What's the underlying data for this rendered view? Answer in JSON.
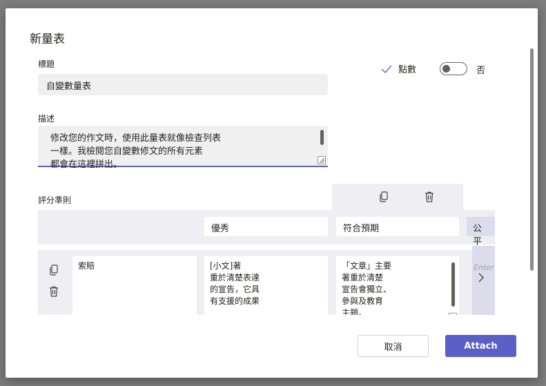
{
  "dialog": {
    "title": "新量表"
  },
  "form": {
    "title_label": "標題",
    "title_value": "自變數量表",
    "description_label": "描述",
    "description_value": "修改您的作文時，使用此量表就像檢查列表\n一樣。我檢閱您自變數修文的所有元素\n都會在這裡拼出。"
  },
  "points": {
    "label": "點數",
    "toggle_state": "否"
  },
  "rubric": {
    "label": "評分準則",
    "levels": [
      "優秀",
      "符合預期",
      "公平"
    ],
    "criterion": {
      "name": "索賠",
      "cells": [
        "[小文]著\n重於清楚表達\n的宣告，它具\n有支援的成果",
        "「文章」主要\n著重於清楚\n宣告會獨立、\n參與及教育\n主題。"
      ]
    },
    "new_level_placeholder": "Enter"
  },
  "buttons": {
    "cancel": "取消",
    "attach": "Attach"
  },
  "colors": {
    "accent": "#5b5fc7",
    "panel": "#efeff3"
  },
  "icons": [
    "check-icon",
    "copy-icon",
    "trash-icon",
    "chevron-right-icon"
  ]
}
